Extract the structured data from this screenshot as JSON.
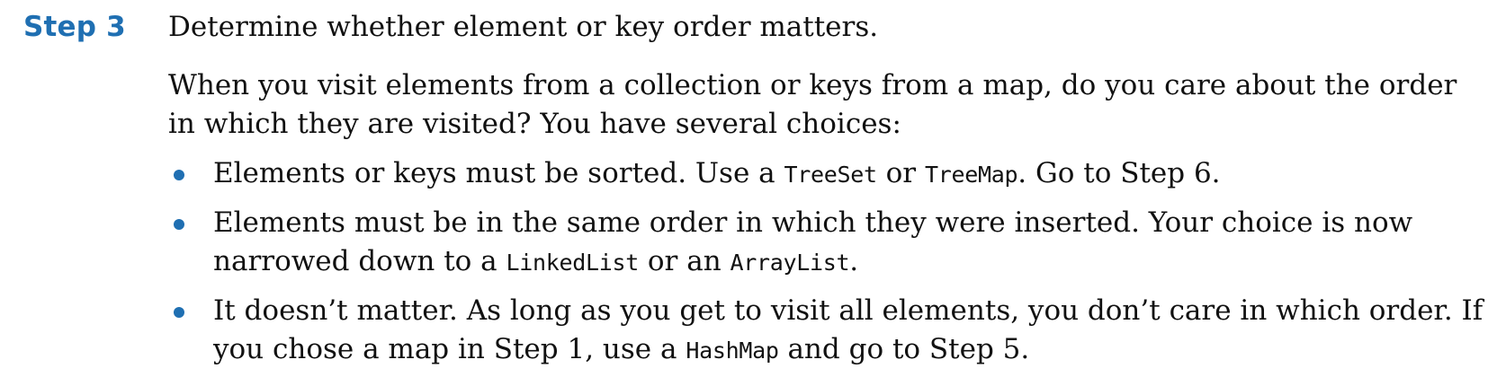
{
  "step": {
    "label": "Step 3",
    "title": "Determine whether element or key order matters."
  },
  "intro": "When you visit elements from a collection or keys from a map, do you care about the order in which they are visited? You have several choices:",
  "bullets": [
    {
      "parts": [
        {
          "text": "Elements or keys must be sorted. Use a ",
          "code": false
        },
        {
          "text": "TreeSet",
          "code": true
        },
        {
          "text": " or ",
          "code": false
        },
        {
          "text": "TreeMap",
          "code": true
        },
        {
          "text": ". Go to Step 6.",
          "code": false
        }
      ]
    },
    {
      "parts": [
        {
          "text": "Elements must be in the same order in which they were inserted. Your choice is now narrowed down to a ",
          "code": false
        },
        {
          "text": "LinkedList",
          "code": true
        },
        {
          "text": " or an ",
          "code": false
        },
        {
          "text": "ArrayList",
          "code": true
        },
        {
          "text": ".",
          "code": false
        }
      ]
    },
    {
      "parts": [
        {
          "text": "It doesn’t matter. As long as you get to visit all elements, you don’t care in which order. If you chose a map in Step 1, use a ",
          "code": false
        },
        {
          "text": "HashMap",
          "code": true
        },
        {
          "text": " and go to Step 5.",
          "code": false
        }
      ]
    }
  ],
  "colors": {
    "accent": "#1f6fb2",
    "text": "#111111"
  }
}
